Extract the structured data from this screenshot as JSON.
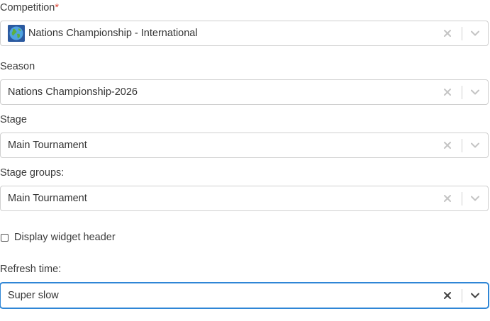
{
  "fields": {
    "competition": {
      "label": "Competition",
      "required_marker": "*",
      "value": "Nations Championship - International",
      "flag_icon": "globe-icon"
    },
    "season": {
      "label": "Season",
      "value": "Nations Championship-2026"
    },
    "stage": {
      "label": "Stage",
      "value": "Main Tournament"
    },
    "stage_groups": {
      "label": "Stage groups:",
      "value": "Main Tournament"
    },
    "display_header": {
      "label": "Display widget header",
      "checked": false
    },
    "refresh_time": {
      "label": "Refresh time:",
      "value": "Super slow"
    }
  },
  "colors": {
    "required": "#e04a3a",
    "focus_border": "#2f86d6",
    "border": "#cfcfcf",
    "icon_muted": "#c4c4c4",
    "icon_active": "#444444"
  }
}
